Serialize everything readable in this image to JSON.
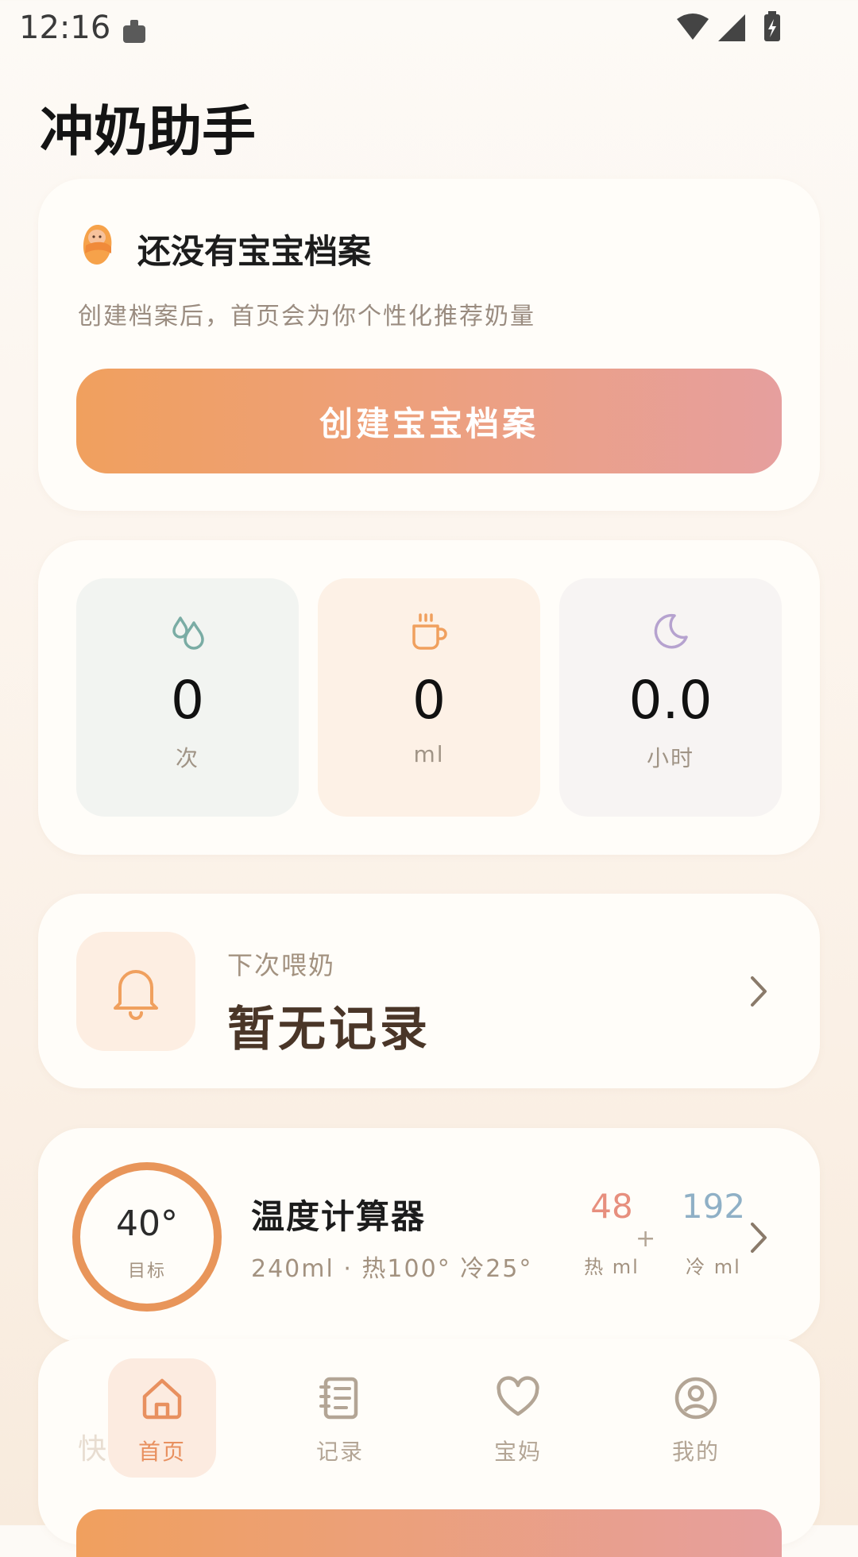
{
  "status_bar": {
    "time": "12:16"
  },
  "app_title": "冲奶助手",
  "profile_card": {
    "title": "还没有宝宝档案",
    "subtitle": "创建档案后，首页会为你个性化推荐奶量",
    "button_label": "创建宝宝档案"
  },
  "stats": [
    {
      "icon": "water-drops-icon",
      "value": "0",
      "unit": "次",
      "icon_color": "#7aaca4"
    },
    {
      "icon": "cup-icon",
      "value": "0",
      "unit": "ml",
      "icon_color": "#f0a05e"
    },
    {
      "icon": "moon-icon",
      "value": "0.0",
      "unit": "小时",
      "icon_color": "#b6a2cf"
    }
  ],
  "next_feed": {
    "label": "下次喂奶",
    "value": "暂无记录"
  },
  "temp_calc": {
    "target_temp": "40°",
    "target_label": "目标",
    "title": "温度计算器",
    "subtitle": "240ml · 热100° 冷25°",
    "hot_value": "48",
    "hot_unit": "热 ml",
    "plus": "+",
    "cold_value": "192",
    "cold_unit": "冷 ml"
  },
  "quick_actions": {
    "label": "快捷操作"
  },
  "bottom_nav": [
    {
      "label": "首页",
      "icon": "home-icon",
      "active": true
    },
    {
      "label": "记录",
      "icon": "notebook-icon",
      "active": false
    },
    {
      "label": "宝妈",
      "icon": "heart-icon",
      "active": false
    },
    {
      "label": "我的",
      "icon": "user-circle-icon",
      "active": false
    }
  ],
  "colors": {
    "accent": "#f0a05e",
    "accent_end": "#e69f9e",
    "nav_active": "#e8905f",
    "nav_inactive": "#b3a595"
  }
}
